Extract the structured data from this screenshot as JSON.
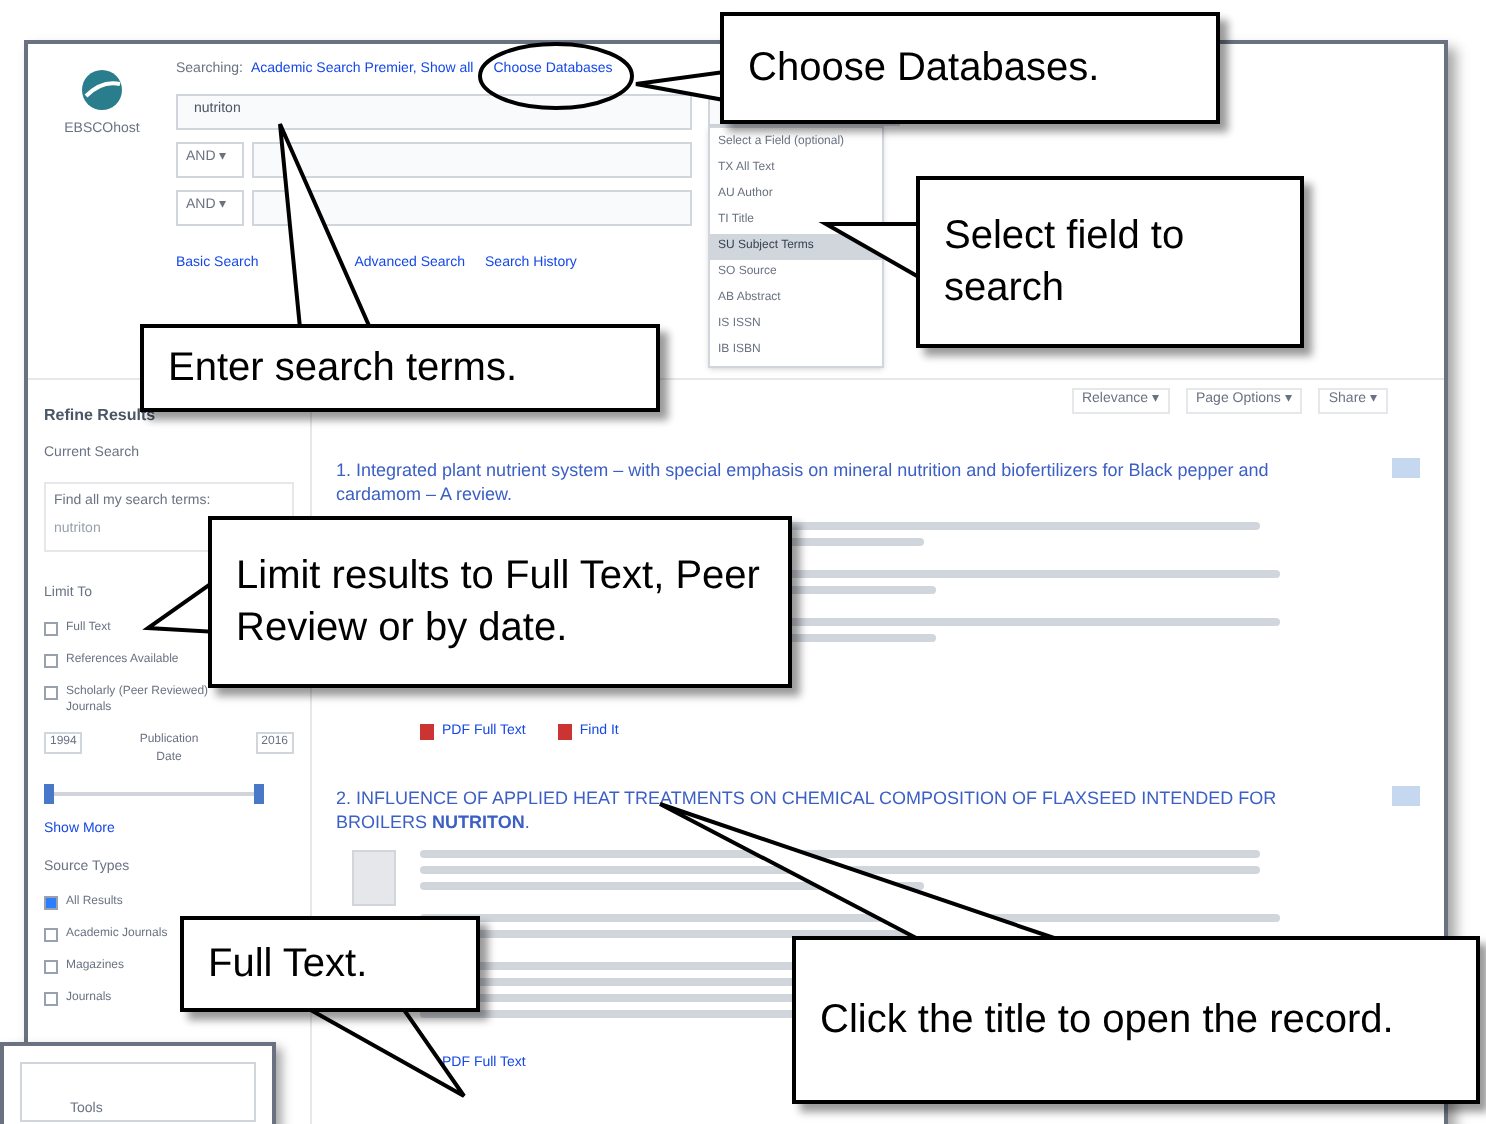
{
  "annotations": [
    {
      "text": "Choose Databases."
    },
    {
      "text": "Select field to search"
    },
    {
      "text": "Enter search terms."
    },
    {
      "text": "Limit results to Full Text, Peer Review or by date."
    },
    {
      "text": "Full Text."
    },
    {
      "text": "Click the title to open the record."
    }
  ],
  "header": {
    "logo": "EBSCOhost",
    "searching_label": "Searching:",
    "databases": "Academic Search Premier, Show all",
    "choose_link": "Choose Databases",
    "query": "nutriton",
    "rows": [
      {
        "operator": "AND ▾"
      },
      {
        "operator": "AND ▾"
      }
    ],
    "links": [
      "Basic Search",
      "Advanced Search",
      "Search History"
    ],
    "field_options": [
      {
        "label": "Select a Field (optional)",
        "selected": false
      },
      {
        "label": "TX All Text",
        "selected": false
      },
      {
        "label": "AU Author",
        "selected": false
      },
      {
        "label": "TI Title",
        "selected": false
      },
      {
        "label": "SU Subject Terms",
        "selected": true
      },
      {
        "label": "SO Source",
        "selected": false
      },
      {
        "label": "AB Abstract",
        "selected": false
      },
      {
        "label": "IS ISSN",
        "selected": false
      },
      {
        "label": "IB ISBN",
        "selected": false
      }
    ]
  },
  "sidebar": {
    "title": "Refine Results",
    "current_search": "Current Search",
    "find_all_label": "Find all my search terms:",
    "term": "nutriton",
    "limit_to": "Limit To",
    "limits": [
      {
        "label": "Full Text",
        "checked": false
      },
      {
        "label": "References Available",
        "checked": false
      },
      {
        "label": "Scholarly (Peer Reviewed) Journals",
        "checked": false
      }
    ],
    "date_from": "1994",
    "date_label": "Publication Date",
    "date_to": "2016",
    "slider_thumbs": [
      {
        "level": 0
      },
      {
        "level": 1
      }
    ],
    "show_more": "Show More",
    "source_types": "Source Types",
    "sources": [
      {
        "label": "All Results",
        "checked": true
      },
      {
        "label": "Academic Journals",
        "checked": false
      },
      {
        "label": "Magazines",
        "checked": false
      },
      {
        "label": "Journals",
        "checked": false
      }
    ]
  },
  "toolbar": [
    "Relevance ▾",
    "Page Options ▾",
    "Share ▾"
  ],
  "results": [
    {
      "number": "1.",
      "title": "Integrated plant nutrient system – with special emphasis on mineral nutrition and biofertilizers for Black pepper and cardamom – A review.",
      "links": [
        "PDF Full Text",
        "Find It"
      ]
    },
    {
      "number": "2.",
      "title": "INFLUENCE OF APPLIED HEAT TREATMENTS ON CHEMICAL COMPOSITION OF FLAXSEED INTENDED FOR BROILERS **NUTRITON**.",
      "links": [
        "PDF Full Text"
      ]
    }
  ],
  "inset": {
    "label": "Tools"
  }
}
